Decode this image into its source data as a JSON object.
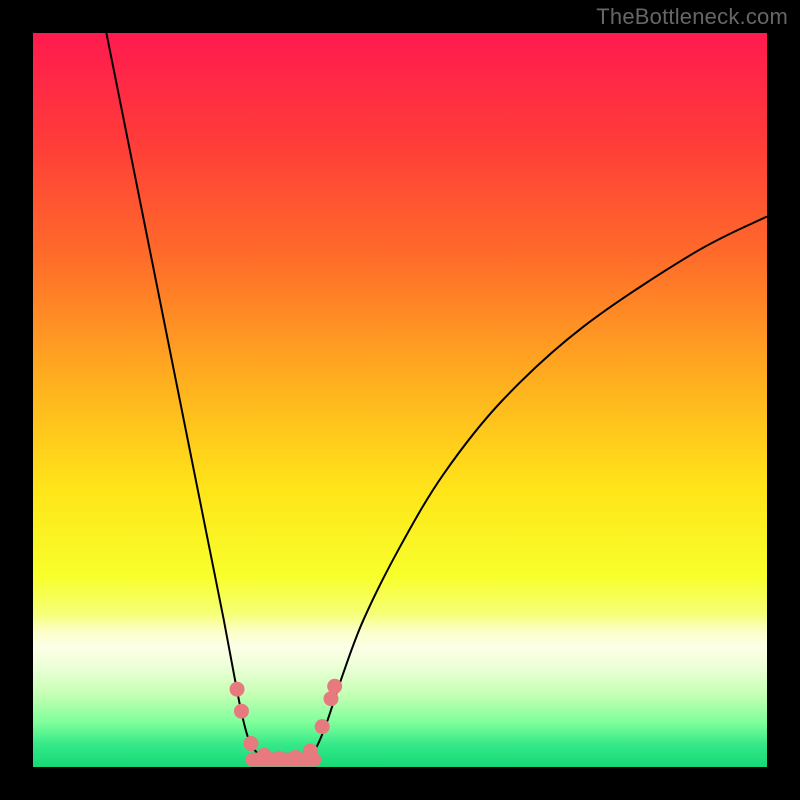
{
  "watermark": "TheBottleneck.com",
  "frame": {
    "outer": 800,
    "inner_left": 33,
    "inner_top": 33,
    "inner_size": 734,
    "border_color": "#000000"
  },
  "gradient": {
    "stops": [
      {
        "pct": 0,
        "color": "#ff1a4f"
      },
      {
        "pct": 14,
        "color": "#ff3a3a"
      },
      {
        "pct": 30,
        "color": "#ff6a2a"
      },
      {
        "pct": 48,
        "color": "#ffb11f"
      },
      {
        "pct": 62,
        "color": "#ffe419"
      },
      {
        "pct": 74,
        "color": "#f8ff2b"
      },
      {
        "pct": 79,
        "color": "#f6ff74"
      },
      {
        "pct": 81.5,
        "color": "#fbffc6"
      },
      {
        "pct": 83.5,
        "color": "#fdffe6"
      },
      {
        "pct": 86,
        "color": "#efffdb"
      },
      {
        "pct": 90,
        "color": "#c7ffb5"
      },
      {
        "pct": 94,
        "color": "#7dff9b"
      },
      {
        "pct": 97,
        "color": "#34e887"
      },
      {
        "pct": 100,
        "color": "#16d977"
      }
    ]
  },
  "chart_data": {
    "type": "line",
    "title": "",
    "xlabel": "",
    "ylabel": "",
    "x_range": [
      0,
      100
    ],
    "y_range": [
      0,
      100
    ],
    "series": [
      {
        "name": "bottleneck-curve",
        "stroke": "#000000",
        "stroke_width": 2,
        "points": [
          {
            "x": 10.0,
            "y": 100.0
          },
          {
            "x": 12.0,
            "y": 90.0
          },
          {
            "x": 14.0,
            "y": 80.0
          },
          {
            "x": 16.0,
            "y": 70.0
          },
          {
            "x": 18.0,
            "y": 60.0
          },
          {
            "x": 20.0,
            "y": 50.0
          },
          {
            "x": 22.0,
            "y": 40.0
          },
          {
            "x": 24.0,
            "y": 30.0
          },
          {
            "x": 26.0,
            "y": 20.0
          },
          {
            "x": 27.5,
            "y": 12.0
          },
          {
            "x": 28.5,
            "y": 7.0
          },
          {
            "x": 29.5,
            "y": 3.5
          },
          {
            "x": 31.0,
            "y": 1.5
          },
          {
            "x": 33.0,
            "y": 0.8
          },
          {
            "x": 35.0,
            "y": 0.7
          },
          {
            "x": 37.0,
            "y": 1.0
          },
          {
            "x": 38.5,
            "y": 2.5
          },
          {
            "x": 40.0,
            "y": 6.0
          },
          {
            "x": 42.0,
            "y": 12.0
          },
          {
            "x": 45.0,
            "y": 20.0
          },
          {
            "x": 50.0,
            "y": 30.0
          },
          {
            "x": 56.0,
            "y": 40.0
          },
          {
            "x": 64.0,
            "y": 50.0
          },
          {
            "x": 75.0,
            "y": 60.0
          },
          {
            "x": 90.0,
            "y": 70.0
          },
          {
            "x": 100.0,
            "y": 75.0
          }
        ]
      }
    ],
    "markers": {
      "color": "#e77a7f",
      "radius": 7.5,
      "points": [
        {
          "x": 27.8,
          "y": 10.6
        },
        {
          "x": 28.4,
          "y": 7.6
        },
        {
          "x": 29.7,
          "y": 3.2
        },
        {
          "x": 31.5,
          "y": 1.6
        },
        {
          "x": 33.5,
          "y": 1.2
        },
        {
          "x": 35.8,
          "y": 1.3
        },
        {
          "x": 37.8,
          "y": 2.2
        },
        {
          "x": 39.4,
          "y": 5.5
        },
        {
          "x": 40.6,
          "y": 9.3
        },
        {
          "x": 41.1,
          "y": 11.0
        }
      ]
    },
    "baseline": {
      "stroke": "#e77a7f",
      "stroke_width": 14,
      "y": 1.0,
      "x_from": 29.9,
      "x_to": 38.3
    }
  }
}
